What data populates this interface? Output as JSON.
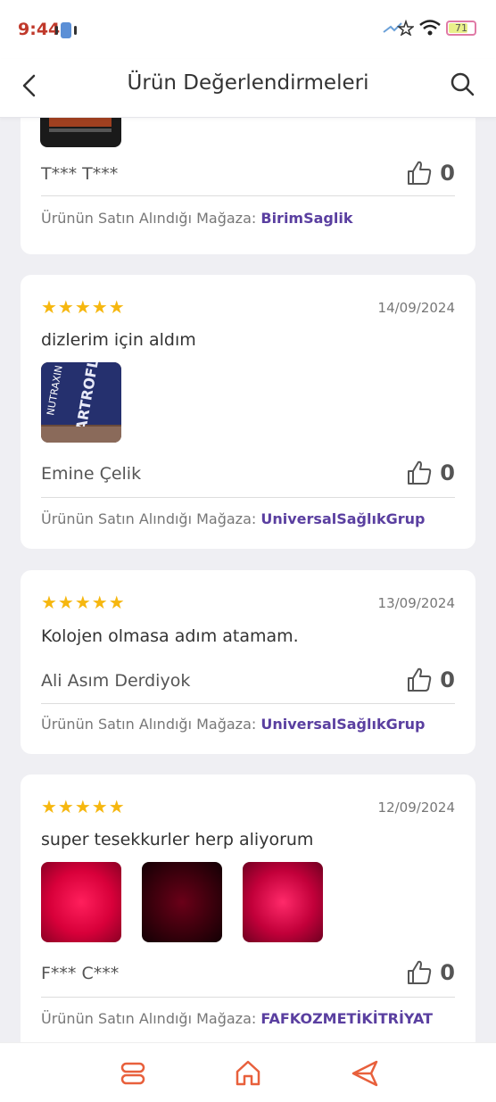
{
  "status_bar": {
    "time": "9:44",
    "battery": "71"
  },
  "header": {
    "title": "Ürün Değerlendirmeleri"
  },
  "store_label": "Ürünün Satın Alındığı Mağaza:",
  "reviews": [
    {
      "reviewer": "T*** T***",
      "likes": "0",
      "store": "BirimSaglik"
    },
    {
      "stars": "★★★★★",
      "date": "14/09/2024",
      "text": "dizlerim için aldım",
      "reviewer": "Emine Çelik",
      "likes": "0",
      "store": "UniversalSağlıkGrup"
    },
    {
      "stars": "★★★★★",
      "date": "13/09/2024",
      "text": "Kolojen olmasa adım atamam.",
      "reviewer": "Ali Asım Derdiyok",
      "likes": "0",
      "store": "UniversalSağlıkGrup"
    },
    {
      "stars": "★★★★★",
      "date": "12/09/2024",
      "text": "super tesekkurler herp aliyorum",
      "reviewer": "F*** C***",
      "likes": "0",
      "store": "FAFKOZMETİKİTRİYAT"
    }
  ],
  "icons": {
    "back": "chevron-left-icon",
    "search": "search-icon",
    "like": "thumbs-up-icon",
    "nav_left": "menu-icon",
    "nav_home": "home-icon",
    "nav_right": "send-icon"
  },
  "colors": {
    "accent": "#e8603c",
    "store_link": "#5a3fa0",
    "star": "#f6b70f"
  }
}
